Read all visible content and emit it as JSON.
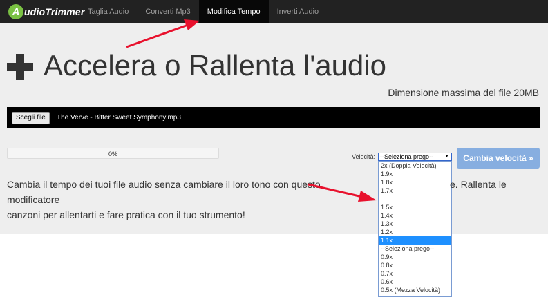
{
  "brand": {
    "badge": "A",
    "name": "udioTrimmer"
  },
  "nav": {
    "items": [
      "Taglia Audio",
      "Converti Mp3",
      "Modifica Tempo",
      "Inverti Audio"
    ]
  },
  "page": {
    "title": "Accelera o Rallenta l'audio",
    "max_size": "Dimensione massima del file 20MB",
    "file_button": "Scegli file",
    "file_name": "The Verve - Bitter Sweet Symphony.mp3",
    "progress_text": "0%",
    "progress": 0,
    "speed_label": "Velocità:",
    "select_value": "--Seleziona prego--",
    "options": [
      "2x (Doppia Velocità)",
      "1.9x",
      "1.8x",
      "1.7x",
      "",
      "1.5x",
      "1.4x",
      "1.3x",
      "1.2x",
      "1.1x",
      "--Seleziona prego--",
      "0.9x",
      "0.8x",
      "0.7x",
      "0.6x",
      "0.5x (Mezza Velocità)"
    ],
    "highlighted_option": "1.1x",
    "button": "Cambia velocità »",
    "description": "Cambia il tempo dei tuoi file audio senza cambiare il loro tono con questo modificatore",
    "description_tail": "e. Rallenta le",
    "description_line2": "canzoni per allentarti e fare pratica con il tuo strumento!"
  },
  "colors": {
    "nav_bg": "#222222",
    "nav_active": "#080808",
    "hero_bg": "#eeeeee",
    "button_bg": "#87aee0",
    "highlight": "#1e90ff",
    "arrow": "#e8112d",
    "logo_green": "#7ac143"
  }
}
